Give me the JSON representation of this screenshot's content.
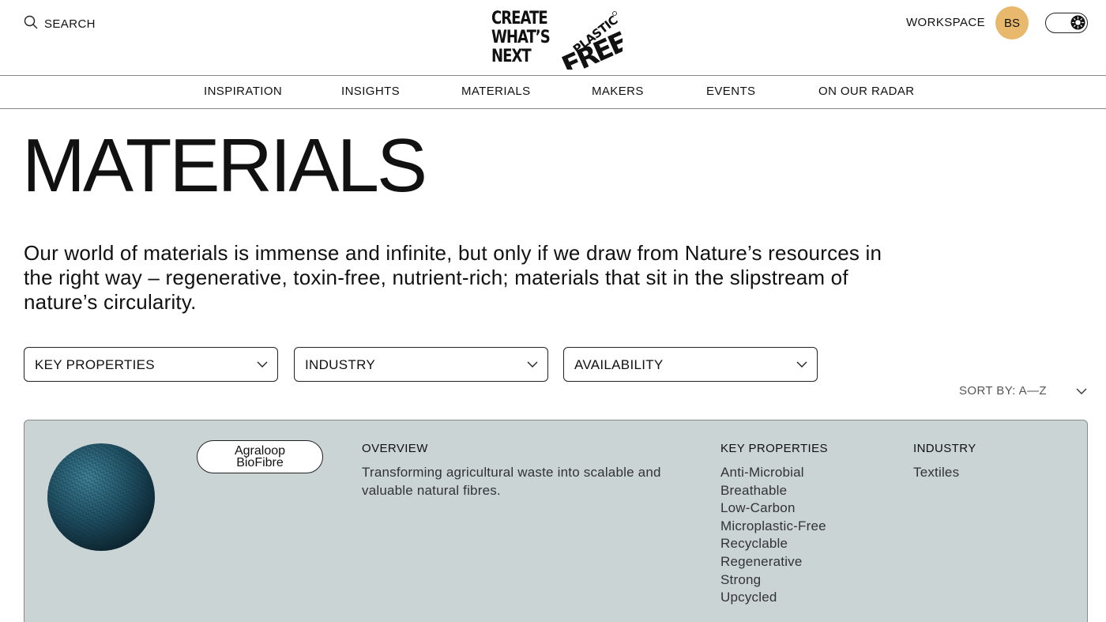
{
  "header": {
    "search_label": "SEARCH",
    "logo_lines": [
      "CREATE",
      "WHAT’S",
      "NEXT"
    ],
    "logo_mark_top": "PLASTIC",
    "logo_mark_bottom": "FREE",
    "workspace_label": "WORKSPACE",
    "avatar_initials": "BS",
    "avatar_color": "#e8b86d"
  },
  "nav": {
    "items": [
      "INSPIRATION",
      "INSIGHTS",
      "MATERIALS",
      "MAKERS",
      "EVENTS",
      "ON OUR RADAR"
    ]
  },
  "page": {
    "title": "MATERIALS",
    "intro": "Our world of materials is immense and infinite, but only if we draw from Nature’s resources in the right way – regenerative, toxin-free, nutrient-rich; materials that sit in the slipstream of nature’s circularity."
  },
  "filters": [
    {
      "label": "KEY PROPERTIES"
    },
    {
      "label": "INDUSTRY"
    },
    {
      "label": "AVAILABILITY"
    }
  ],
  "sort": {
    "label": "SORT BY: A—Z"
  },
  "card": {
    "background": "#cbd4d5",
    "name_line1": "Agraloop",
    "name_line2": "BioFibre",
    "overview_heading": "OVERVIEW",
    "overview_text_line1": "Transforming agricultural waste into scalable and",
    "overview_text_line2": "valuable natural fibres.",
    "key_properties_heading": "KEY PROPERTIES",
    "key_properties": [
      "Anti-Microbial",
      "Breathable",
      "Low-Carbon",
      "Microplastic-Free",
      "Recyclable",
      "Regenerative",
      "Strong",
      "Upcycled"
    ],
    "industry_heading": "INDUSTRY",
    "industry": [
      "Textiles"
    ]
  }
}
